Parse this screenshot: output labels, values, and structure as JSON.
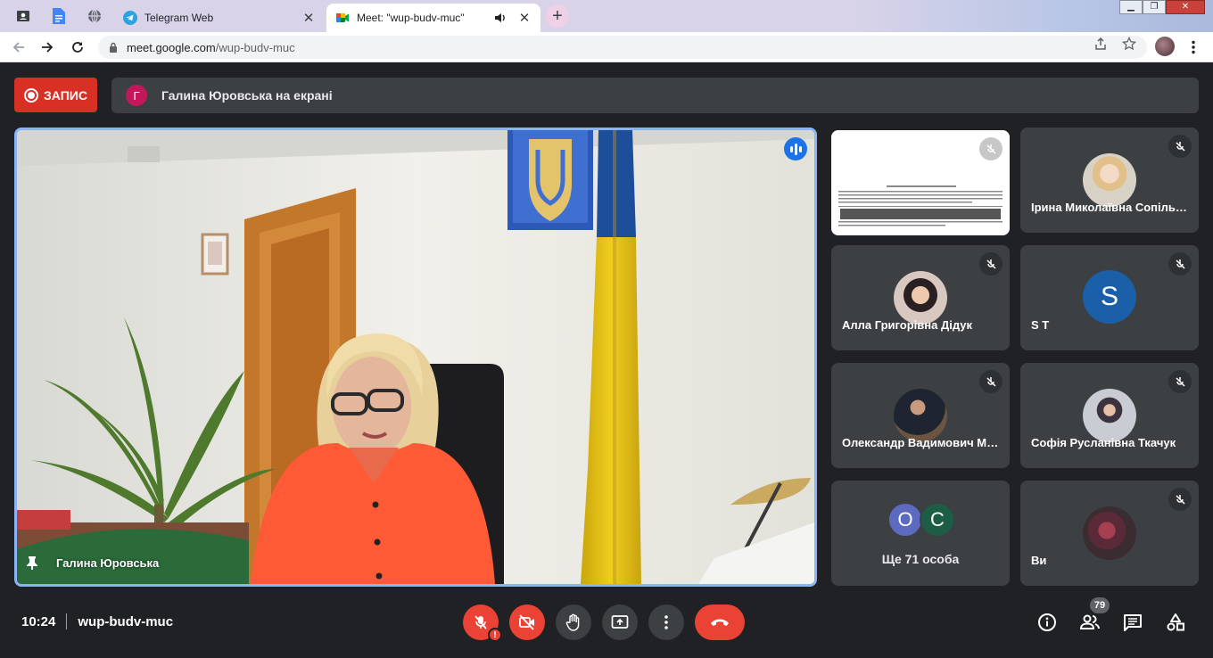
{
  "browser": {
    "tabs": [
      {
        "title": "Telegram Web",
        "icon": "telegram-icon"
      },
      {
        "title": "Meet: \"wup-budv-muc\"",
        "icon": "google-meet-icon",
        "active": true
      }
    ],
    "url_host": "meet.google.com",
    "url_path": "/wup-budv-muc"
  },
  "meet": {
    "record_label": "ЗАПИС",
    "presenter_initial": "Г",
    "presenting_text": "Галина Юровська на екрані",
    "main_speaker": "Галина Юровська",
    "participants": [
      {
        "name": "Ірина Миколаївна Сопільник",
        "type": "photo",
        "muted": true
      },
      {
        "name": "Алла Григорівна Дідук",
        "type": "photo",
        "muted": true
      },
      {
        "name": "S T",
        "initial": "S",
        "type": "letter",
        "muted": true
      },
      {
        "name": "Олександр Вадимович Марченко",
        "type": "photo",
        "muted": true
      },
      {
        "name": "Софія Русланівна Ткачук",
        "type": "photo",
        "muted": true
      },
      {
        "name": "Ви",
        "type": "photo",
        "muted": true
      }
    ],
    "more": {
      "initials": [
        "О",
        "С"
      ],
      "text": "Ще 71 особа"
    },
    "time": "10:24",
    "meeting_code": "wup-budv-muc",
    "people_count": "79",
    "colors": {
      "accent": "#8ab4f8",
      "danger": "#ea4335",
      "surface": "#3c4043",
      "background": "#202124"
    }
  }
}
